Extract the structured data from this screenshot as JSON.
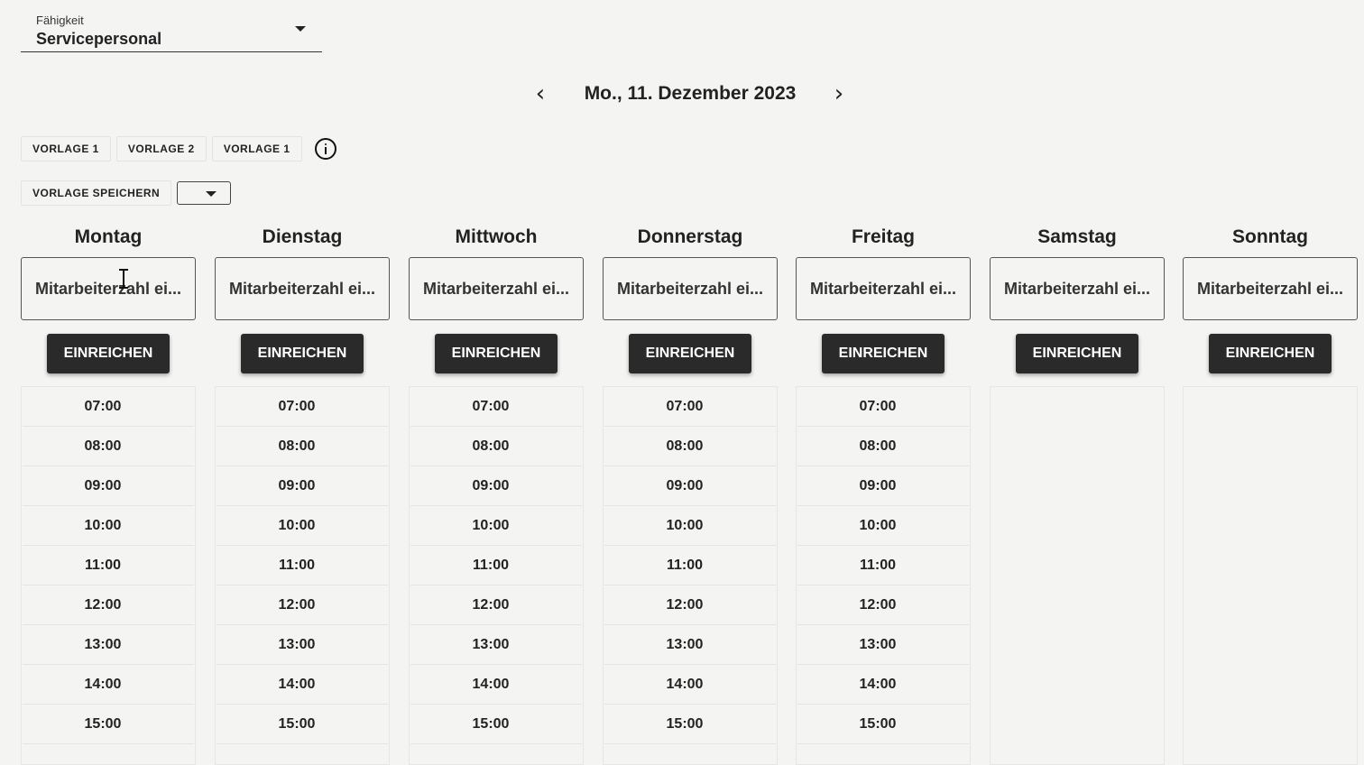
{
  "skill": {
    "label": "Fähigkeit",
    "value": "Servicepersonal"
  },
  "date_nav": {
    "title": "Mo., 11. Dezember 2023",
    "prev_icon": "chevron-left-icon",
    "next_icon": "chevron-right-icon"
  },
  "templates": {
    "buttons": [
      "VORLAGE 1",
      "VORLAGE 2",
      "VORLAGE 1"
    ],
    "info_icon": "info-icon"
  },
  "save": {
    "label": "VORLAGE SPEICHERN",
    "selected": ""
  },
  "days": [
    {
      "name": "Montag",
      "input_placeholder": "Mitarbeiterzahl ei...",
      "submit": "EINREICHEN",
      "slots": [
        "07:00",
        "08:00",
        "09:00",
        "10:00",
        "11:00",
        "12:00",
        "13:00",
        "14:00",
        "15:00"
      ]
    },
    {
      "name": "Dienstag",
      "input_placeholder": "Mitarbeiterzahl ei...",
      "submit": "EINREICHEN",
      "slots": [
        "07:00",
        "08:00",
        "09:00",
        "10:00",
        "11:00",
        "12:00",
        "13:00",
        "14:00",
        "15:00"
      ]
    },
    {
      "name": "Mittwoch",
      "input_placeholder": "Mitarbeiterzahl ei...",
      "submit": "EINREICHEN",
      "slots": [
        "07:00",
        "08:00",
        "09:00",
        "10:00",
        "11:00",
        "12:00",
        "13:00",
        "14:00",
        "15:00"
      ]
    },
    {
      "name": "Donnerstag",
      "input_placeholder": "Mitarbeiterzahl ei...",
      "submit": "EINREICHEN",
      "slots": [
        "07:00",
        "08:00",
        "09:00",
        "10:00",
        "11:00",
        "12:00",
        "13:00",
        "14:00",
        "15:00"
      ]
    },
    {
      "name": "Freitag",
      "input_placeholder": "Mitarbeiterzahl ei...",
      "submit": "EINREICHEN",
      "slots": [
        "07:00",
        "08:00",
        "09:00",
        "10:00",
        "11:00",
        "12:00",
        "13:00",
        "14:00",
        "15:00"
      ]
    },
    {
      "name": "Samstag",
      "input_placeholder": "Mitarbeiterzahl ei...",
      "submit": "EINREICHEN",
      "slots": []
    },
    {
      "name": "Sonntag",
      "input_placeholder": "Mitarbeiterzahl ei...",
      "submit": "EINREICHEN",
      "slots": []
    }
  ]
}
